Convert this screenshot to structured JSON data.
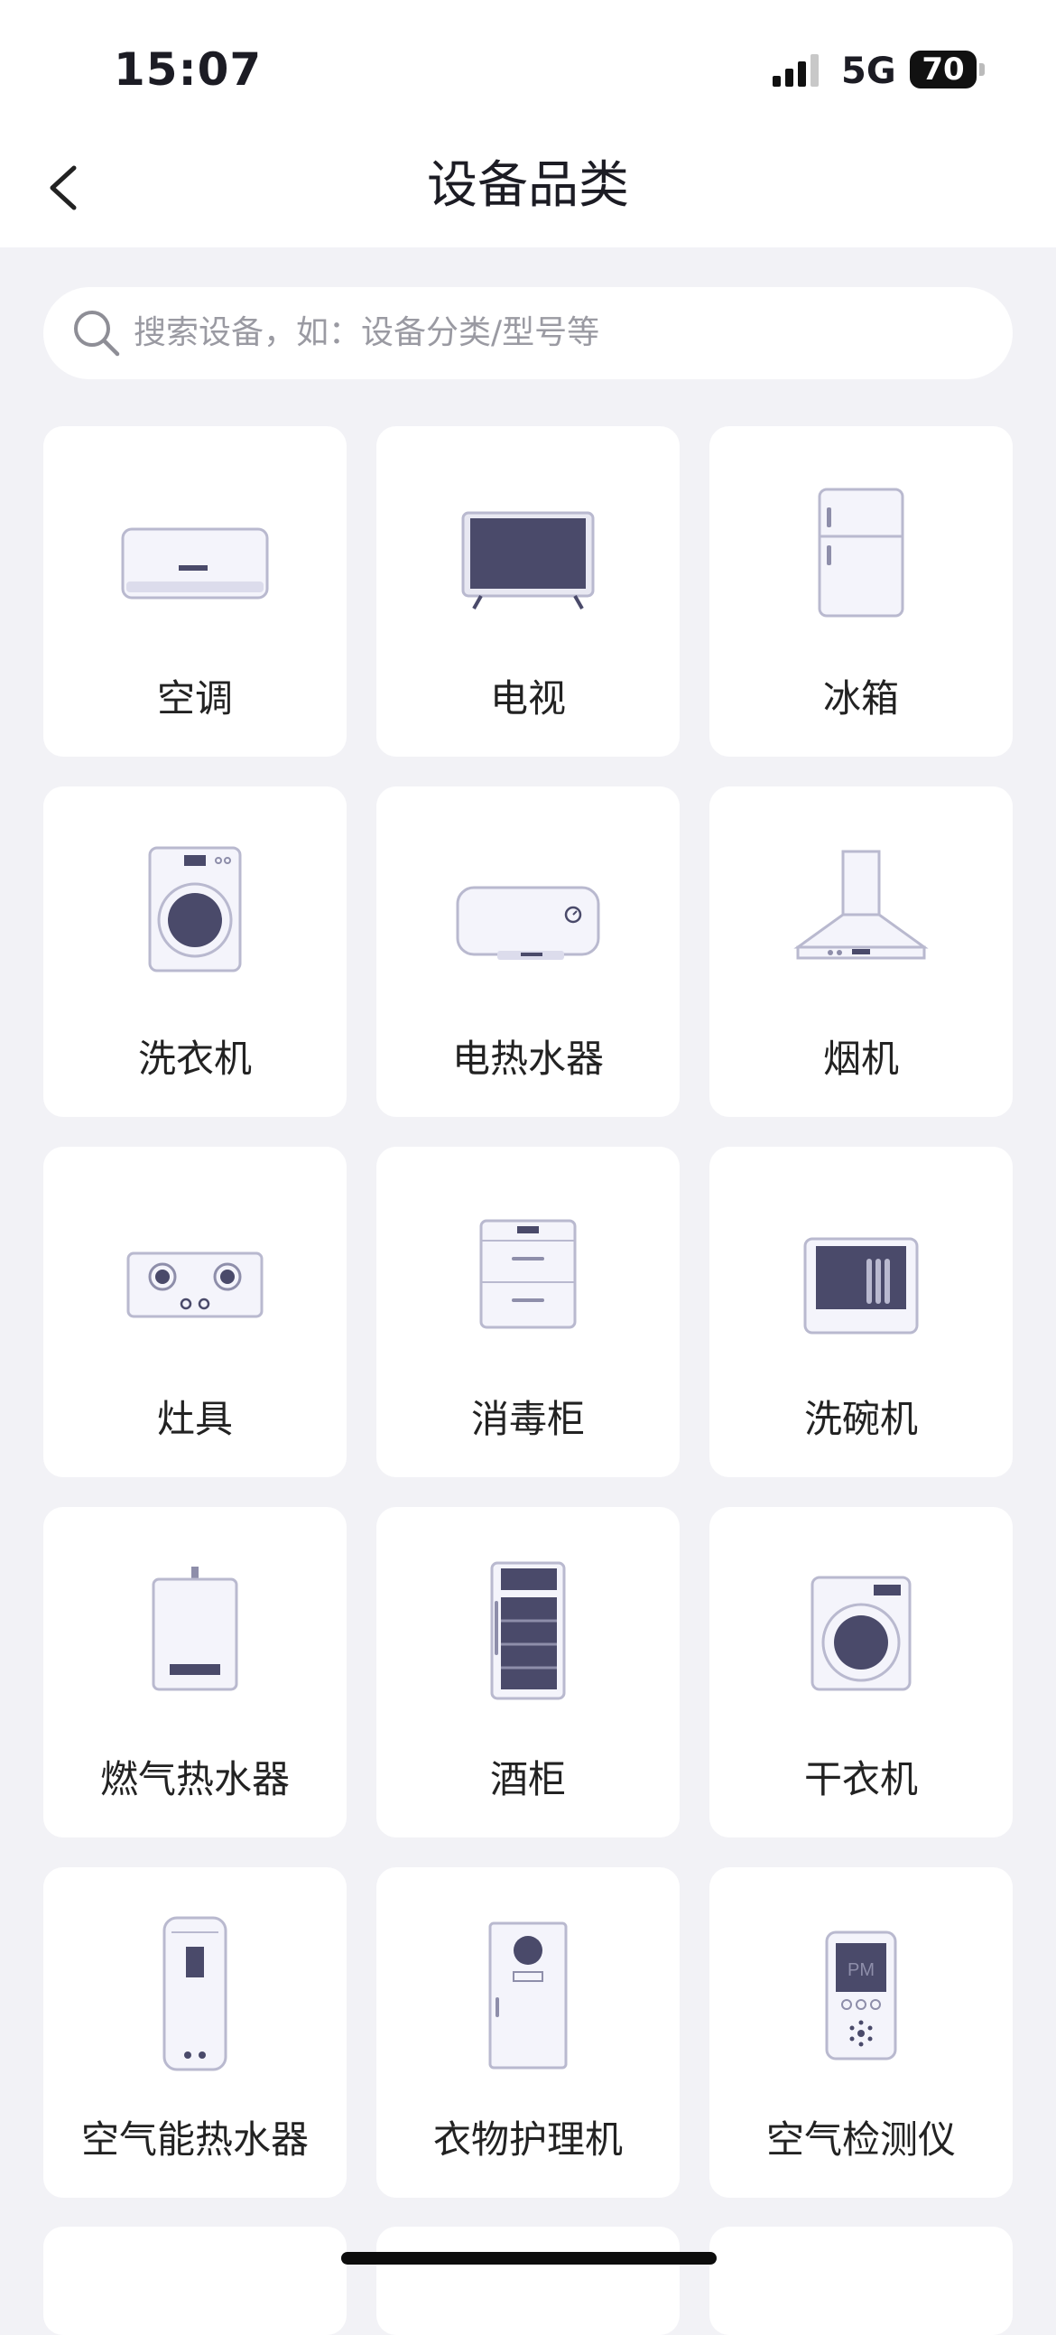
{
  "status_bar": {
    "time": "15:07",
    "network": "5G",
    "battery": "70"
  },
  "header": {
    "title": "设备品类"
  },
  "search": {
    "placeholder": "搜索设备，如：设备分类/型号等"
  },
  "categories": [
    {
      "label": "空调",
      "icon": "air-conditioner-icon"
    },
    {
      "label": "电视",
      "icon": "tv-icon"
    },
    {
      "label": "冰箱",
      "icon": "refrigerator-icon"
    },
    {
      "label": "洗衣机",
      "icon": "washing-machine-icon"
    },
    {
      "label": "电热水器",
      "icon": "electric-water-heater-icon"
    },
    {
      "label": "烟机",
      "icon": "range-hood-icon"
    },
    {
      "label": "灶具",
      "icon": "gas-stove-icon"
    },
    {
      "label": "消毒柜",
      "icon": "disinfection-cabinet-icon"
    },
    {
      "label": "洗碗机",
      "icon": "dishwasher-icon"
    },
    {
      "label": "燃气热水器",
      "icon": "gas-water-heater-icon"
    },
    {
      "label": "酒柜",
      "icon": "wine-cabinet-icon"
    },
    {
      "label": "干衣机",
      "icon": "dryer-icon"
    },
    {
      "label": "空气能热水器",
      "icon": "air-energy-water-heater-icon"
    },
    {
      "label": "衣物护理机",
      "icon": "clothes-care-machine-icon"
    },
    {
      "label": "空气检测仪",
      "icon": "air-quality-monitor-icon"
    }
  ],
  "colors": {
    "icon_body": "#f4f4fb",
    "icon_outline": "#b9b9cf",
    "icon_dark": "#4a4a6a",
    "page_bg": "#f2f2f6"
  },
  "icon_text": {
    "pm_label": "PM"
  }
}
